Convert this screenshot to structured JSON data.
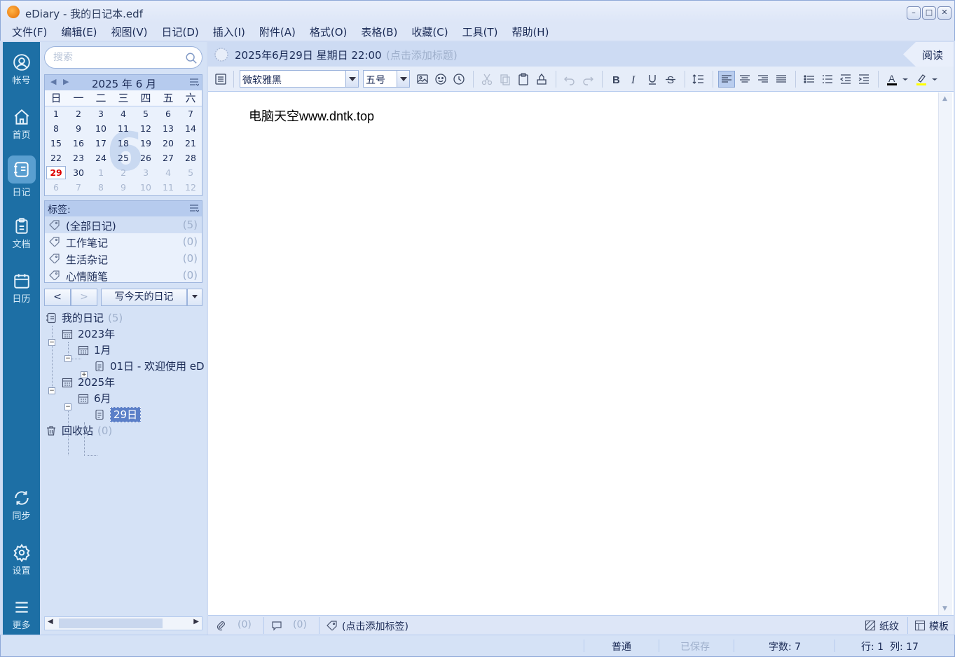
{
  "window": {
    "title": "eDiary - 我的日记本.edf"
  },
  "menu": [
    "文件(F)",
    "编辑(E)",
    "视图(V)",
    "日记(D)",
    "插入(I)",
    "附件(A)",
    "格式(O)",
    "表格(B)",
    "收藏(C)",
    "工具(T)",
    "帮助(H)"
  ],
  "nav": [
    {
      "label": "帐号",
      "icon": "account-icon"
    },
    {
      "label": "首页",
      "icon": "home-icon"
    },
    {
      "label": "日记",
      "icon": "diary-icon",
      "active": true
    },
    {
      "label": "文档",
      "icon": "document-icon"
    },
    {
      "label": "日历",
      "icon": "calendar-icon"
    },
    {
      "label": "同步",
      "icon": "sync-icon"
    },
    {
      "label": "设置",
      "icon": "gear-icon"
    },
    {
      "label": "更多",
      "icon": "menu-icon"
    }
  ],
  "search": {
    "placeholder": "搜索"
  },
  "calendar": {
    "title": "2025 年 6 月",
    "big_month": "6",
    "weekdays": [
      "日",
      "一",
      "二",
      "三",
      "四",
      "五",
      "六"
    ],
    "weeks": [
      [
        "1",
        "2",
        "3",
        "4",
        "5",
        "6",
        "7"
      ],
      [
        "8",
        "9",
        "10",
        "11",
        "12",
        "13",
        "14"
      ],
      [
        "15",
        "16",
        "17",
        "18",
        "19",
        "20",
        "21"
      ],
      [
        "22",
        "23",
        "24",
        "25",
        "26",
        "27",
        "28"
      ],
      [
        "29",
        "30",
        "1",
        "2",
        "3",
        "4",
        "5"
      ],
      [
        "6",
        "7",
        "8",
        "9",
        "10",
        "11",
        "12"
      ]
    ],
    "today": "29"
  },
  "tags": {
    "title": "标签:",
    "items": [
      {
        "name": "(全部日记)",
        "count": "(5)"
      },
      {
        "name": "工作笔记",
        "count": "(0)"
      },
      {
        "name": "生活杂记",
        "count": "(0)"
      },
      {
        "name": "心情随笔",
        "count": "(0)"
      }
    ]
  },
  "diary_nav": {
    "prev": "<",
    "next": ">",
    "write_today": "写今天的日记"
  },
  "tree": {
    "root": {
      "label": "我的日记",
      "count": "(5)"
    },
    "y2023": "2023年",
    "m2023_1": "1月",
    "e2023_1": "01日 - 欢迎使用 eD",
    "y2025": "2025年",
    "m2025_6": "6月",
    "e2025_6": "29日",
    "trash": {
      "label": "回收站",
      "count": "(0)"
    }
  },
  "entry": {
    "date": "2025年6月29日 星期日 22:00",
    "title_placeholder": "(点击添加标题)",
    "read_tab": "阅读",
    "font": "微软雅黑",
    "size": "五号",
    "content": "电脑天空www.dntk.top"
  },
  "entry_foot": {
    "attach_count": "(0)",
    "comment_count": "(0)",
    "tag_placeholder": "(点击添加标签)",
    "paper": "纸纹",
    "template": "模板"
  },
  "status": {
    "mode": "普通",
    "saved": "已保存",
    "words": "字数: 7",
    "position": "行: 1  列: 17"
  }
}
